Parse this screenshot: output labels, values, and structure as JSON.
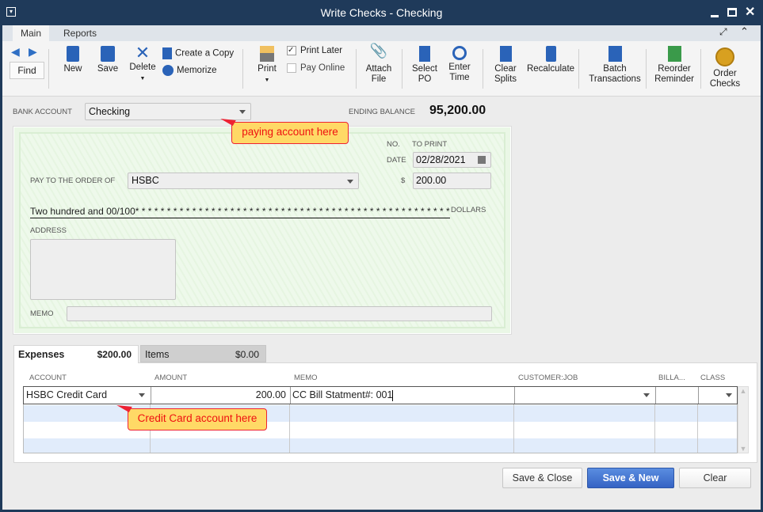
{
  "window": {
    "title": "Write Checks - Checking"
  },
  "ribbon_tabs": [
    "Main",
    "Reports"
  ],
  "toolbar": {
    "find": "Find",
    "new": "New",
    "save": "Save",
    "delete": "Delete",
    "create_copy": "Create a Copy",
    "memorize": "Memorize",
    "print": "Print",
    "print_later": "Print Later",
    "print_later_checked": true,
    "pay_online": "Pay Online",
    "pay_online_checked": false,
    "attach_file": [
      "Attach",
      "File"
    ],
    "select_po": [
      "Select",
      "PO"
    ],
    "enter_time": [
      "Enter",
      "Time"
    ],
    "clear_splits": [
      "Clear",
      "Splits"
    ],
    "recalculate": "Recalculate",
    "batch_transactions": [
      "Batch",
      "Transactions"
    ],
    "reorder_reminder": [
      "Reorder",
      "Reminder"
    ],
    "order_checks": [
      "Order",
      "Checks"
    ]
  },
  "header": {
    "bank_account_label": "BANK ACCOUNT",
    "bank_account": "Checking",
    "ending_balance_label": "ENDING BALANCE",
    "ending_balance": "95,200.00"
  },
  "check": {
    "no_label": "NO.",
    "no_value": "TO PRINT",
    "date_label": "DATE",
    "date": "02/28/2021",
    "payee_label": "PAY TO THE ORDER OF",
    "payee": "HSBC",
    "amount_label": "$",
    "amount": "200.00",
    "amount_words": "Two hundred and 00/100* * * * * * * * * * * * * * * * * * * * * * * * * * * * * * * * * * * * * * * * * * * * * * * * * * *",
    "dollars_label": "DOLLARS",
    "address_label": "ADDRESS",
    "memo_label": "MEMO",
    "memo": ""
  },
  "callouts": {
    "bank": "paying account here",
    "credit": "Credit Card account here"
  },
  "detail_tabs": [
    {
      "label": "Expenses",
      "amount": "$200.00"
    },
    {
      "label": "Items",
      "amount": "$0.00"
    }
  ],
  "grid": {
    "columns": [
      "ACCOUNT",
      "AMOUNT",
      "MEMO",
      "CUSTOMER:JOB",
      "BILLA...",
      "CLASS"
    ],
    "rows": [
      {
        "account": "HSBC Credit Card",
        "amount": "200.00",
        "memo": "CC Bill Statment#: 001",
        "customer_job": "",
        "billable": "",
        "class": ""
      }
    ]
  },
  "buttons": {
    "save_close": "Save & Close",
    "save_new": "Save & New",
    "clear": "Clear"
  },
  "colors": {
    "titlebar": "#1f3a5a",
    "primary_button": "#3d6fcf",
    "callout_fill": "#ffd966",
    "callout_border": "#ee2222",
    "check_bg": "#eaf7e6"
  }
}
